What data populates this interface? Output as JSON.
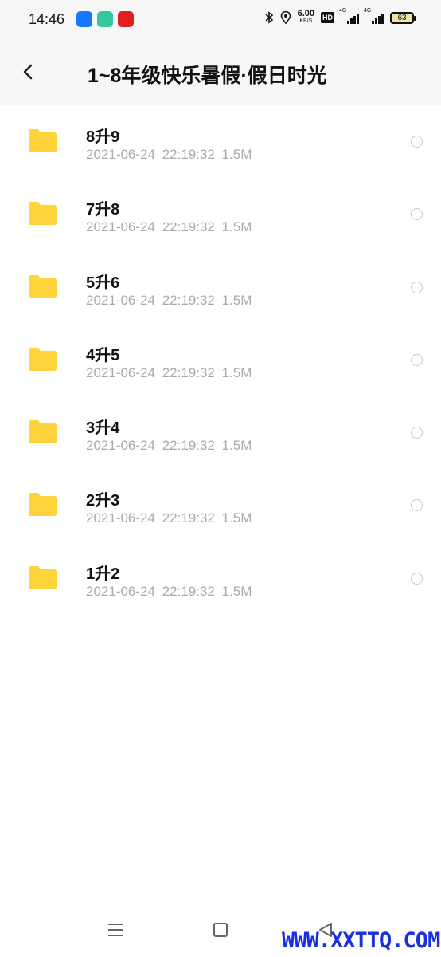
{
  "status_bar": {
    "time": "14:46",
    "net_speed": "6.00",
    "net_unit": "KB/S",
    "hd": "HD",
    "sim1": "4G",
    "sim2": "4G",
    "battery": "63",
    "app_icons": [
      {
        "name": "alipay-icon",
        "color": "#1677ff"
      },
      {
        "name": "app-green-icon",
        "color": "#34c8a0"
      },
      {
        "name": "app-red-icon",
        "color": "#e02020"
      }
    ]
  },
  "header": {
    "title": "1~8年级快乐暑假·假日时光",
    "back_icon": "chevron-left-icon"
  },
  "folders": [
    {
      "name": "8升9",
      "date": "2021-06-24",
      "time": "22:19:32",
      "size": "1.5M"
    },
    {
      "name": "7升8",
      "date": "2021-06-24",
      "time": "22:19:32",
      "size": "1.5M"
    },
    {
      "name": "5升6",
      "date": "2021-06-24",
      "time": "22:19:32",
      "size": "1.5M"
    },
    {
      "name": "4升5",
      "date": "2021-06-24",
      "time": "22:19:32",
      "size": "1.5M"
    },
    {
      "name": "3升4",
      "date": "2021-06-24",
      "time": "22:19:32",
      "size": "1.5M"
    },
    {
      "name": "2升3",
      "date": "2021-06-24",
      "time": "22:19:32",
      "size": "1.5M"
    },
    {
      "name": "1升2",
      "date": "2021-06-24",
      "time": "22:19:32",
      "size": "1.5M"
    }
  ],
  "colors": {
    "folder": "#ffd43b",
    "watermark": "#1a2fe0"
  },
  "watermark": "WWW.XXTTQ.COM"
}
